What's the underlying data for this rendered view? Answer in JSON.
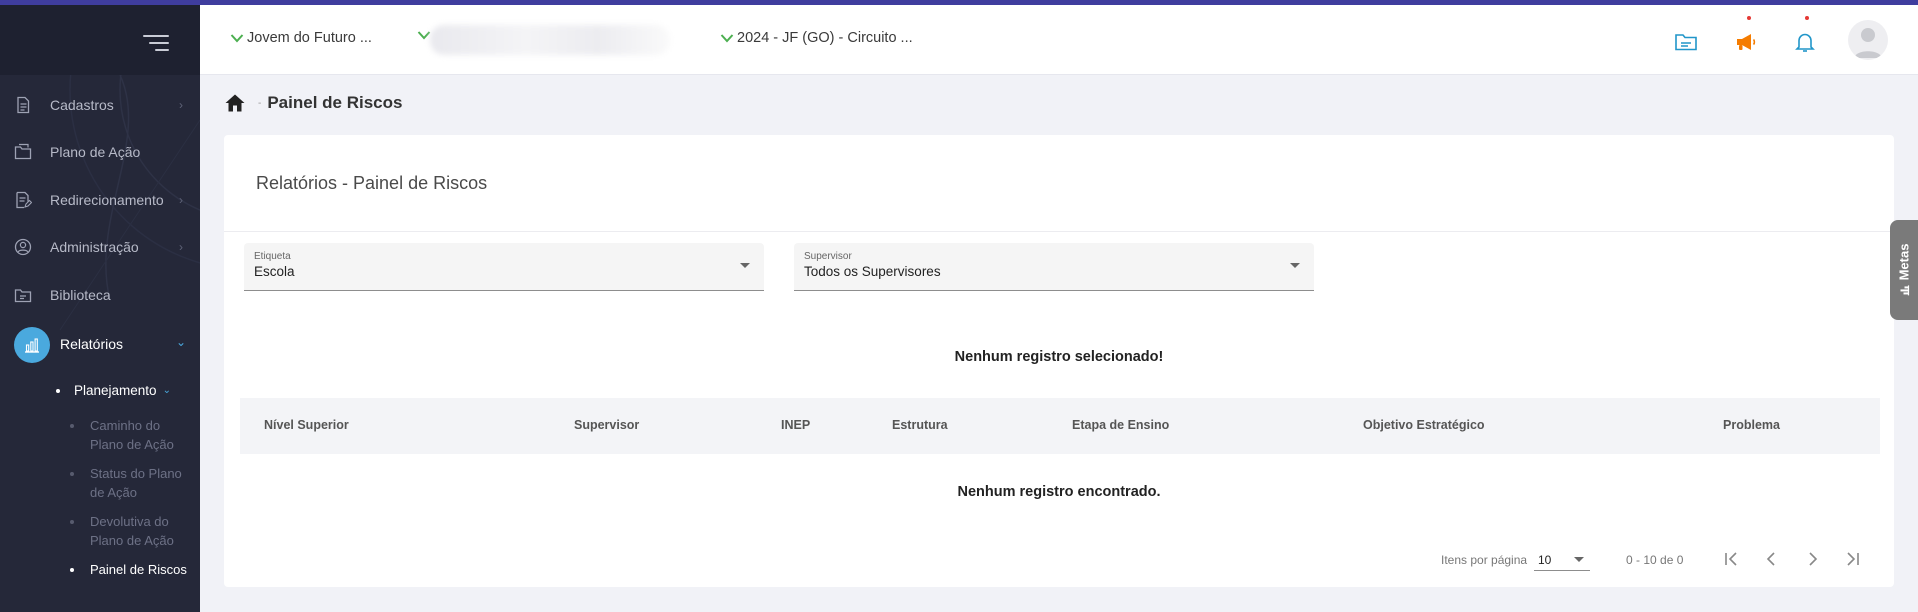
{
  "sidebar": {
    "items": [
      {
        "label": "Cadastros",
        "icon": "document-icon",
        "has_children": true
      },
      {
        "label": "Plano de Ação",
        "icon": "folder-icon",
        "has_children": false
      },
      {
        "label": "Redirecionamento",
        "icon": "doc-edit-icon",
        "has_children": true
      },
      {
        "label": "Administração",
        "icon": "user-circle-icon",
        "has_children": true
      },
      {
        "label": "Biblioteca",
        "icon": "library-icon",
        "has_children": false
      }
    ],
    "active": {
      "label": "Relatórios",
      "icon": "chart-icon"
    },
    "submenu": {
      "label": "Planejamento"
    },
    "leaves": [
      {
        "label": "Caminho do Plano de Ação"
      },
      {
        "label": "Status do Plano de Ação"
      },
      {
        "label": "Devolutiva do Plano de Ação"
      },
      {
        "label": "Painel de Riscos"
      }
    ]
  },
  "topbar": {
    "selector1": "Jovem do Futuro ...",
    "selector2": "",
    "selector3": "2024 - JF (GO) - Circuito ..."
  },
  "breadcrumb": {
    "separator": "-",
    "title": "Painel de Riscos"
  },
  "card": {
    "title": "Relatórios - Painel de Riscos",
    "filter_etiqueta": {
      "label": "Etiqueta",
      "value": "Escola"
    },
    "filter_supervisor": {
      "label": "Supervisor",
      "value": "Todos os Supervisores"
    },
    "msg_selected": "Nenhum registro selecionado!",
    "columns": [
      "Nível Superior",
      "Supervisor",
      "INEP",
      "Estrutura",
      "Etapa de Ensino",
      "Objetivo Estratégico",
      "Problema"
    ],
    "msg_empty": "Nenhum registro encontrado.",
    "paginator": {
      "items_label": "Itens por página",
      "page_size": "10",
      "range": "0 - 10 de 0"
    }
  },
  "metas_tab": {
    "label": "Metas"
  },
  "colors": {
    "accent": "#4aa9de",
    "sidebar": "#252839",
    "brand_line": "#3f3d9e",
    "chevron_green": "#4caf50",
    "megaphone": "#f57c00",
    "icon_blue": "#2196c9"
  }
}
